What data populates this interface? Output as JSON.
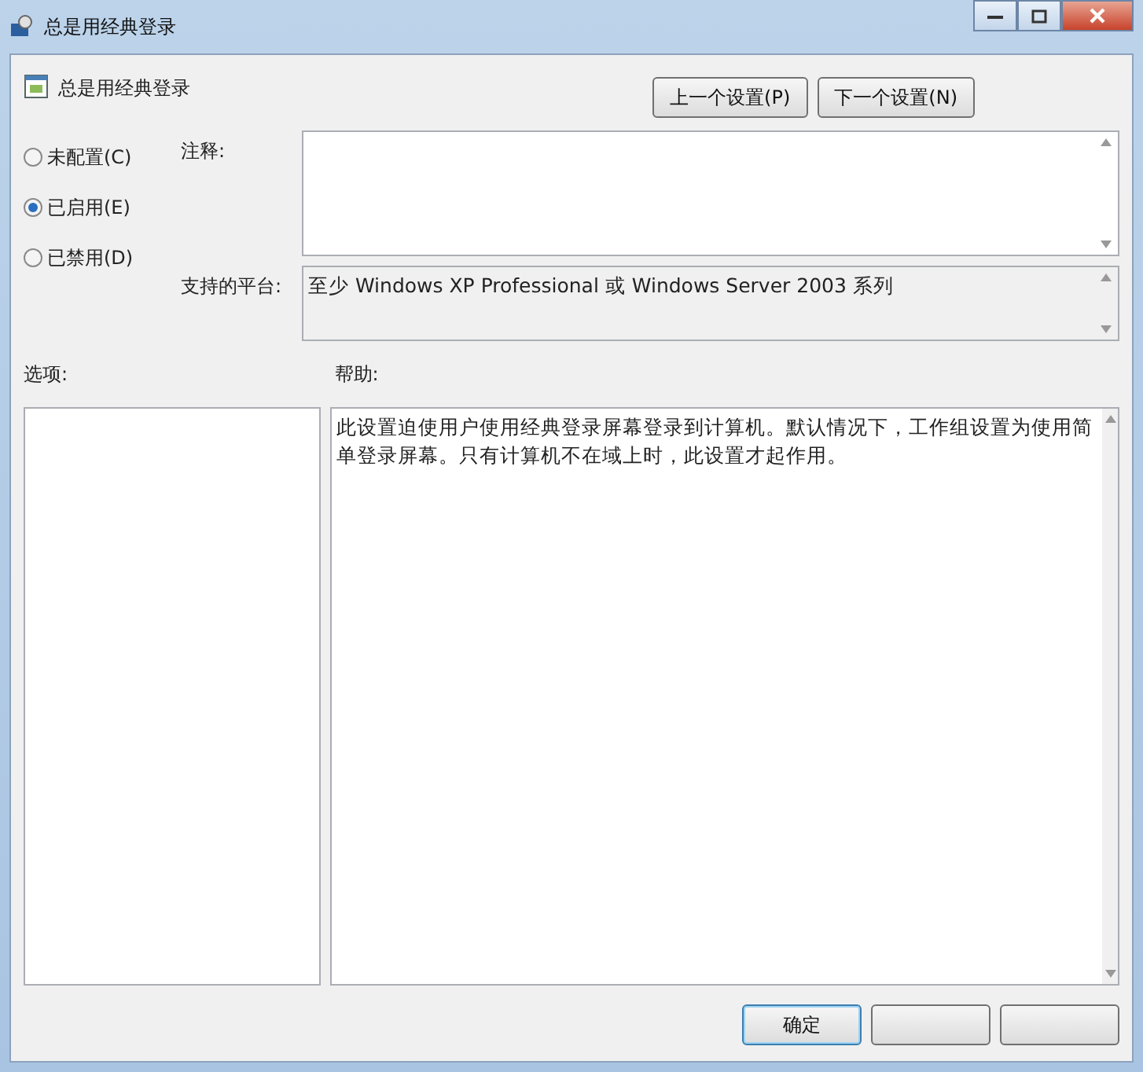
{
  "window": {
    "title": "总是用经典登录"
  },
  "header": {
    "title": "总是用经典登录"
  },
  "nav_buttons": [
    {
      "label": "上一个设置(P)"
    },
    {
      "label": "下一个设置(N)"
    }
  ],
  "state_options": [
    {
      "label": "未配置(C)",
      "selected": false
    },
    {
      "label": "已启用(E)",
      "selected": true
    },
    {
      "label": "已禁用(D)",
      "selected": false
    }
  ],
  "comment": {
    "label": "注释:"
  },
  "platform": {
    "label": "支持的平台:",
    "value": "至少 Windows XP Professional 或 Windows Server 2003 系列"
  },
  "options": {
    "label": "选项:"
  },
  "help": {
    "label": "帮助:",
    "text": "此设置迫使用户使用经典登录屏幕登录到计算机。默认情况下，工作组设置为使用简单登录屏幕。只有计算机不在域上时，此设置才起作用。"
  },
  "footer_buttons": [
    {
      "label": "确定",
      "default": true
    },
    {
      "default": false
    },
    {
      "default": false
    }
  ]
}
